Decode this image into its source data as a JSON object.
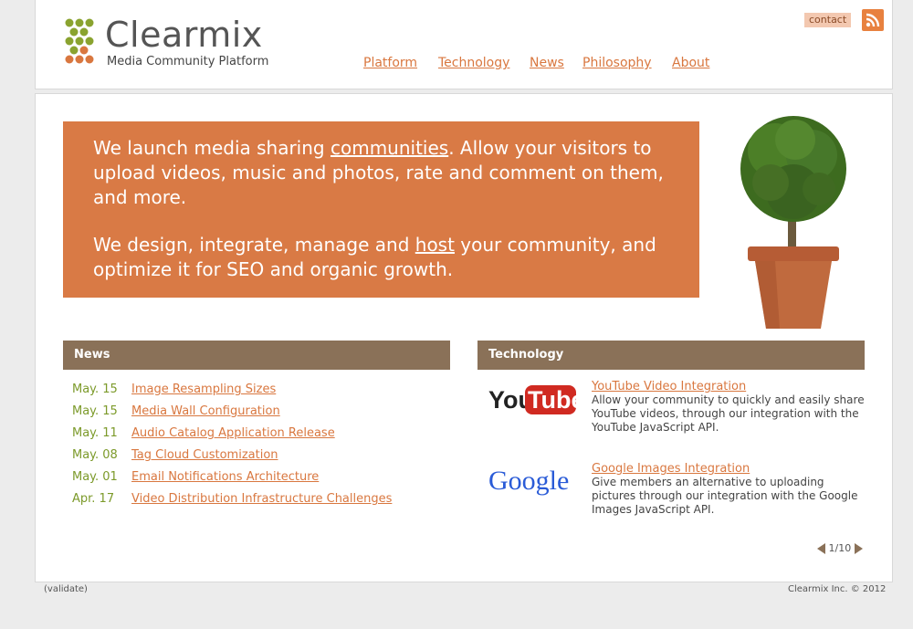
{
  "site": {
    "name": "Clearmix",
    "tagline": "Media Community Platform"
  },
  "nav": {
    "items": [
      "Platform",
      "Technology",
      "News",
      "Philosophy",
      "About"
    ],
    "contact": "contact"
  },
  "hero": {
    "p1_pre": "We launch media sharing ",
    "p1_link": "communities",
    "p1_post": ". Allow your visitors to upload videos, music and photos, rate and comment on them, and more.",
    "p2_pre": "We design, integrate, manage and ",
    "p2_link": "host",
    "p2_post": " your community, and optimize it for SEO and organic growth."
  },
  "news": {
    "title": "News",
    "items": [
      {
        "date": "May. 15",
        "title": "Image Resampling Sizes"
      },
      {
        "date": "May. 15",
        "title": "Media Wall Configuration"
      },
      {
        "date": "May. 11",
        "title": "Audio Catalog Application Release"
      },
      {
        "date": "May. 08",
        "title": "Tag Cloud Customization"
      },
      {
        "date": "May. 01",
        "title": "Email Notifications Architecture"
      },
      {
        "date": "Apr. 17",
        "title": "Video Distribution Infrastructure Challenges"
      }
    ]
  },
  "technology": {
    "title": "Technology",
    "items": [
      {
        "logo": "YouTube",
        "title": "YouTube Video Integration",
        "desc": "Allow your community to quickly and easily share YouTube videos, through our integration with the YouTube JavaScript API."
      },
      {
        "logo": "Google",
        "title": "Google Images Integration",
        "desc": "Give members an alternative to uploading pictures through our integration with the Google Images JavaScript API."
      }
    ],
    "pager": "1/10"
  },
  "footer": {
    "left": "(validate)",
    "right": "Clearmix Inc. © 2012"
  },
  "colors": {
    "accent": "#d9773f",
    "hero_bg": "#d97a45",
    "panel_head": "#8a7158",
    "date_green": "#7c9a2a"
  },
  "icons": [
    "logo-grape-icon",
    "rss-icon",
    "prev-arrow-icon",
    "next-arrow-icon"
  ]
}
